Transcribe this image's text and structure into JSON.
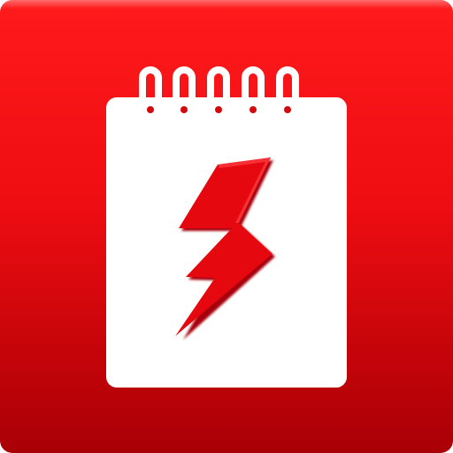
{
  "icon": {
    "name": "notepad-lightning-app-icon",
    "glyphs": [
      "notepad-icon",
      "spiral-binding-icon",
      "lightning-bolt-icon"
    ],
    "colors": {
      "background_top": "#ff1a1c",
      "background_bottom": "#a80006",
      "paper": "#ffffff",
      "bolt": "#e5080e",
      "bolt_shadow": "#a70308"
    }
  }
}
